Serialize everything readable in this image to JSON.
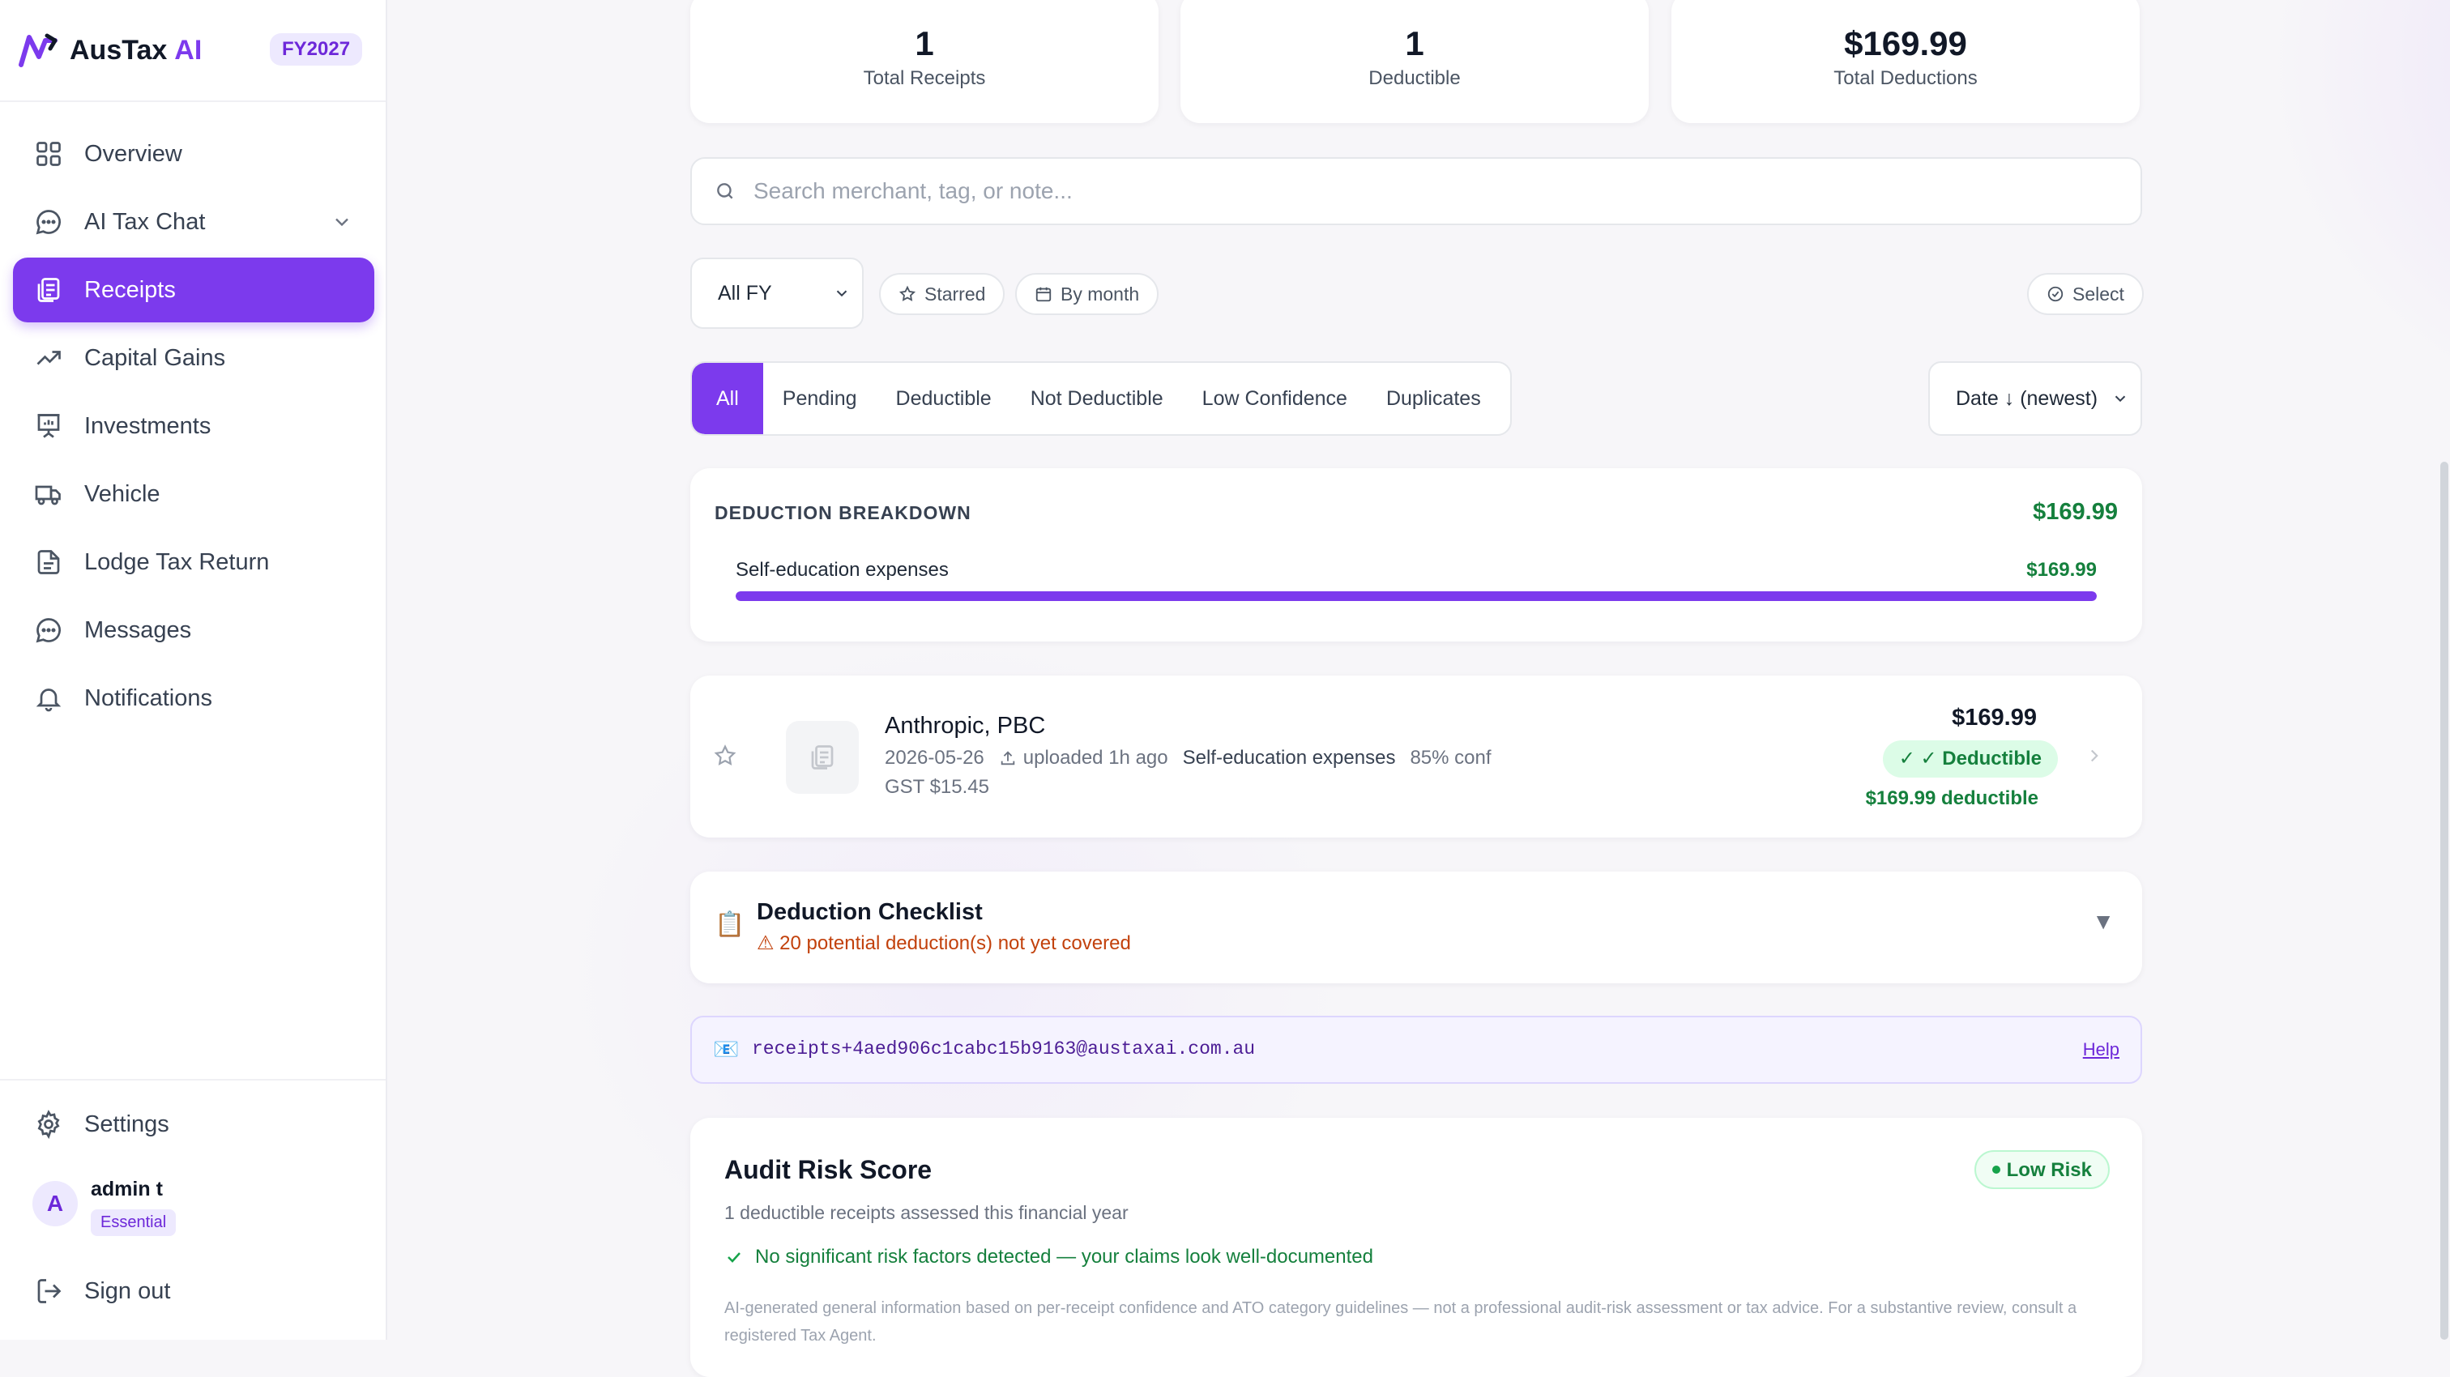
{
  "brand": {
    "name": "AusTax",
    "ai": "AI",
    "fy": "FY2027"
  },
  "nav": [
    {
      "label": "Overview",
      "icon": "grid-icon"
    },
    {
      "label": "AI Tax Chat",
      "icon": "chat-icon",
      "expandable": true
    },
    {
      "label": "Receipts",
      "icon": "receipts-icon",
      "active": true
    },
    {
      "label": "Capital Gains",
      "icon": "trending-up-icon"
    },
    {
      "label": "Investments",
      "icon": "presentation-chart-icon"
    },
    {
      "label": "Vehicle",
      "icon": "truck-icon"
    },
    {
      "label": "Lodge Tax Return",
      "icon": "document-icon"
    },
    {
      "label": "Messages",
      "icon": "message-icon"
    },
    {
      "label": "Notifications",
      "icon": "bell-icon"
    }
  ],
  "footer": {
    "settings": "Settings",
    "user": {
      "initial": "A",
      "name": "admin t",
      "plan": "Essential"
    },
    "signout": "Sign out"
  },
  "stats": [
    {
      "value": "1",
      "label": "Total Receipts"
    },
    {
      "value": "1",
      "label": "Deductible"
    },
    {
      "value": "$169.99",
      "label": "Total Deductions"
    }
  ],
  "search": {
    "placeholder": "Search merchant, tag, or note..."
  },
  "filters": {
    "fy": "All FY",
    "starred": "Starred",
    "by_month": "By month",
    "select": "Select"
  },
  "tabs": [
    "All",
    "Pending",
    "Deductible",
    "Not Deductible",
    "Low Confidence",
    "Duplicates"
  ],
  "sort": "Date ↓ (newest)",
  "breakdown": {
    "title": "DEDUCTION BREAKDOWN",
    "total": "$169.99",
    "items": [
      {
        "category": "Self-education expenses",
        "amount": "$169.99",
        "share": 1.0
      }
    ]
  },
  "receipt": {
    "merchant": "Anthropic, PBC",
    "date": "2026-05-26",
    "uploaded": "uploaded 1h ago",
    "category": "Self-education expenses",
    "confidence": "85% conf",
    "gst": "GST $15.45",
    "amount": "$169.99",
    "status": "✓ ✓ Deductible",
    "deductible": "$169.99 deductible"
  },
  "checklist": {
    "icon": "📋",
    "title": "Deduction Checklist",
    "warning": "⚠ 20 potential deduction(s) not yet covered",
    "toggle": "▼"
  },
  "email": {
    "icon": "📧",
    "address": "receipts+4aed906c1cabc15b9163@austaxai.com.au",
    "help": "Help"
  },
  "audit": {
    "title": "Audit Risk Score",
    "badge": "Low Risk",
    "subtitle": "1 deductible receipts assessed this financial year",
    "ok": "No significant risk factors detected — your claims look well-documented",
    "disclaimer": "AI-generated general information based on per-receipt confidence and ATO category guidelines — not a professional audit-risk assessment or tax advice. For a substantive review, consult a registered Tax Agent."
  },
  "colors": {
    "accent": "#7c3aed",
    "success": "#15803d",
    "warning": "#c2410c"
  }
}
